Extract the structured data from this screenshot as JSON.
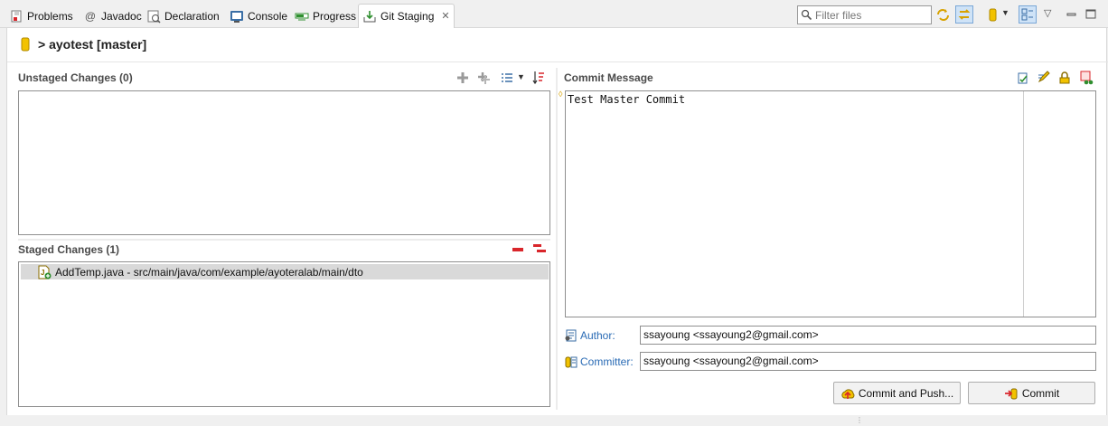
{
  "tabs": [
    {
      "label": "Problems",
      "icon": "problems-icon"
    },
    {
      "label": "Javadoc",
      "icon": "at-icon"
    },
    {
      "label": "Declaration",
      "icon": "declaration-icon"
    },
    {
      "label": "Console",
      "icon": "console-icon"
    },
    {
      "label": "Progress",
      "icon": "progress-icon"
    },
    {
      "label": "Git Staging",
      "icon": "git-staging-icon",
      "active": true
    }
  ],
  "toolbar": {
    "filter_placeholder": "Filter files"
  },
  "repo": {
    "title": "> ayotest [master]"
  },
  "unstaged": {
    "label": "Unstaged Changes (0)"
  },
  "staged": {
    "label": "Staged Changes (1)",
    "items": [
      {
        "text": "AddTemp.java - src/main/java/com/example/ayoteralab/main/dto"
      }
    ]
  },
  "commit": {
    "label": "Commit Message",
    "message": "Test Master Commit",
    "author_label": "Author:",
    "author_value": "ssayoung <ssayoung2@gmail.com>",
    "committer_label": "Committer:",
    "committer_value": "ssayoung <ssayoung2@gmail.com>",
    "commit_push_label": "Commit and Push...",
    "commit_label": "Commit"
  },
  "colors": {
    "link_blue": "#2a6bb5",
    "selection_gray": "#d9d9d9",
    "remove_red": "#d9262b"
  }
}
